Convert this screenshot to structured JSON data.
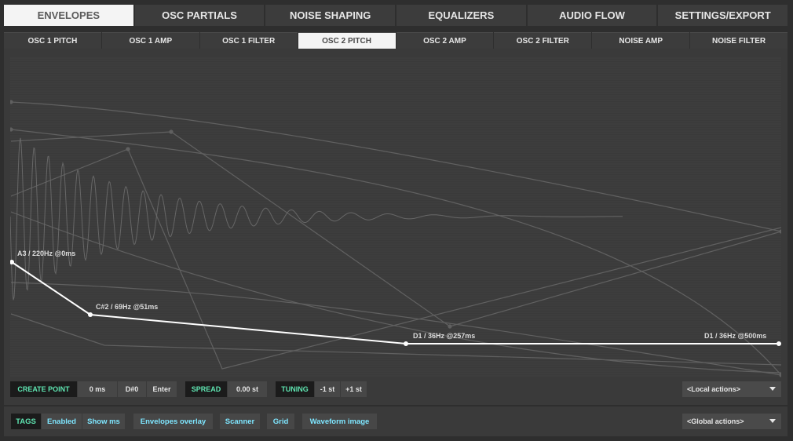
{
  "main_tabs": [
    "ENVELOPES",
    "OSC PARTIALS",
    "NOISE SHAPING",
    "EQUALIZERS",
    "AUDIO FLOW",
    "SETTINGS/EXPORT"
  ],
  "main_tab_active": "ENVELOPES",
  "sub_tabs": [
    "OSC 1 PITCH",
    "OSC 1 AMP",
    "OSC 1 FILTER",
    "OSC 2 PITCH",
    "OSC 2 AMP",
    "OSC 2 FILTER",
    "NOISE AMP",
    "NOISE FILTER"
  ],
  "sub_tab_active": "OSC 2 PITCH",
  "envelope": {
    "points": [
      {
        "label": "A3 / 220Hz @0ms"
      },
      {
        "label": "C#2 / 69Hz @51ms"
      },
      {
        "label": "D1 / 36Hz @257ms"
      },
      {
        "label": "D1 / 36Hz @500ms"
      }
    ]
  },
  "toolbar": {
    "create_point": "CREATE POINT",
    "time_value": "0 ms",
    "note_value": "D#0",
    "enter": "Enter",
    "spread": "SPREAD",
    "spread_value": "0.00 st",
    "tuning": "TUNING",
    "tuning_minus": "-1 st",
    "tuning_plus": "+1 st",
    "local_actions": "<Local actions>"
  },
  "bottom": {
    "tags": "TAGS",
    "enabled": "Enabled",
    "show_ms": "Show ms",
    "envelopes_overlay": "Envelopes overlay",
    "scanner": "Scanner",
    "grid": "Grid",
    "waveform_image": "Waveform image",
    "global_actions": "<Global actions>"
  },
  "colors": {
    "background": "#2e2e2e",
    "panel": "#3a3a3a",
    "tab_active": "#f4f4f4",
    "label_green": "#5fe6b2",
    "toggle_cyan": "#7ee6ff",
    "envelope_line": "#ffffff"
  }
}
